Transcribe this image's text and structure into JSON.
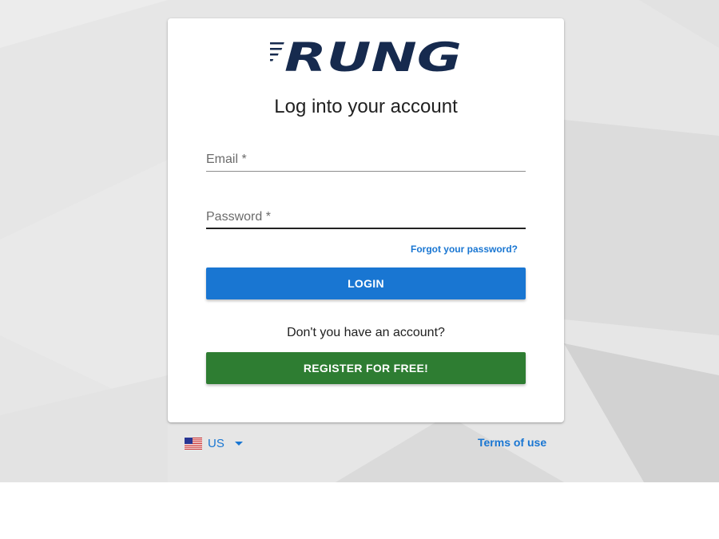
{
  "brand": {
    "logo_text": "RUNG"
  },
  "login": {
    "title": "Log into your account",
    "email_label": "Email *",
    "password_label": "Password *",
    "forgot_link": "Forgot your password?",
    "login_button": "LOGIN"
  },
  "register": {
    "prompt": "Don't you have an account?",
    "button": "REGISTER FOR FREE!"
  },
  "footer": {
    "language_code": "US",
    "terms_link": "Terms of use"
  },
  "colors": {
    "primary": "#1976d2",
    "success": "#2e7d32",
    "logo": "#162a4e"
  },
  "icons": [
    "rung-logo",
    "us-flag-icon",
    "caret-down-icon"
  ]
}
